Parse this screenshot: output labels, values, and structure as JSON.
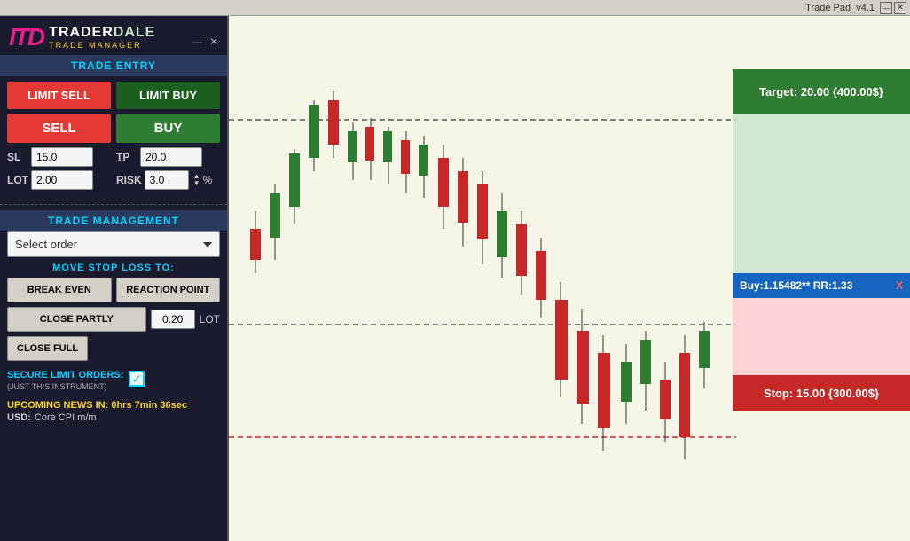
{
  "title_bar": {
    "title": "Trade Pad_v4.1",
    "minimize": "—",
    "close": "✕"
  },
  "logo": {
    "icon": "ITD",
    "trader": "TRADER",
    "dale": "DALE",
    "subtitle": "TRADE MANAGER"
  },
  "trade_entry": {
    "section_label": "TRADE ENTRY",
    "limit_sell_label": "LIMIT SELL",
    "limit_buy_label": "LIMIT BUY",
    "sell_label": "SELL",
    "buy_label": "BUY",
    "sl_label": "SL",
    "sl_value": "15.0",
    "tp_label": "TP",
    "tp_value": "20.0",
    "lot_label": "LOT",
    "lot_value": "2.00",
    "risk_label": "RISK",
    "risk_value": "3.0",
    "pct_label": "%"
  },
  "trade_management": {
    "section_label": "TRADE MANAGEMENT",
    "select_order_placeholder": "Select order",
    "move_sl_label": "MOVE STOP LOSS TO:",
    "break_even_label": "BREAK EVEN",
    "reaction_point_label": "REACTION POINT",
    "close_partly_label": "CLOSE PARTLY",
    "lot_value": "0.20",
    "lot_label": "LOT",
    "close_full_label": "CLOSE FULL",
    "secure_label": "SECURE LIMIT ORDERS:",
    "secure_sublabel": "(JUST THIS INSTRUMENT)"
  },
  "news": {
    "upcoming_label": "UPCOMING NEWS IN:",
    "time": "0hrs 7min 36sec",
    "currency": "USD:",
    "news_name": "Core CPI m/m"
  },
  "chart": {
    "target_label": "Target: 20.00 {400.00$}",
    "entry_label": "Buy:1.15482** RR:1.33",
    "entry_x": "X",
    "stop_label": "Stop: 15.00 {300.00$}"
  },
  "colors": {
    "accent_cyan": "#00d4ff",
    "accent_yellow": "#f9d71c",
    "sell_red": "#e53935",
    "buy_green": "#2e7d32",
    "panel_bg": "#1a1a2e",
    "target_green": "#2e7d32",
    "stop_red": "#c62828",
    "entry_blue": "#1565c0"
  }
}
